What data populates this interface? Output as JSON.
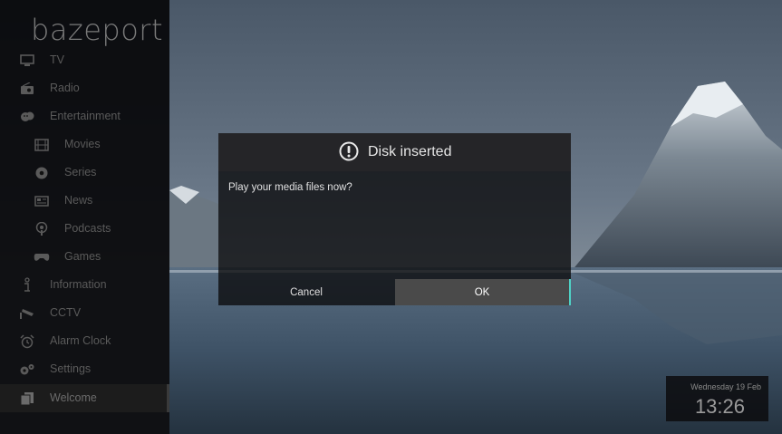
{
  "brand": {
    "logo": "bazeport"
  },
  "sidebar": {
    "items": [
      {
        "label": "TV",
        "icon": "tv-icon"
      },
      {
        "label": "Radio",
        "icon": "radio-icon"
      },
      {
        "label": "Entertainment",
        "icon": "entertainment-icon"
      },
      {
        "label": "Movies",
        "icon": "film-icon"
      },
      {
        "label": "Series",
        "icon": "series-icon"
      },
      {
        "label": "News",
        "icon": "news-icon"
      },
      {
        "label": "Podcasts",
        "icon": "podcast-icon"
      },
      {
        "label": "Games",
        "icon": "gamepad-icon"
      },
      {
        "label": "Information",
        "icon": "info-icon"
      },
      {
        "label": "CCTV",
        "icon": "cctv-icon"
      },
      {
        "label": "Alarm Clock",
        "icon": "alarm-clock-icon"
      },
      {
        "label": "Settings",
        "icon": "settings-icon"
      },
      {
        "label": "Welcome",
        "icon": "welcome-icon"
      }
    ]
  },
  "dialog": {
    "title": "Disk inserted",
    "icon": "alert-icon",
    "message": "Play your media files now?",
    "cancel_label": "Cancel",
    "ok_label": "OK"
  },
  "clock": {
    "date": "Wednesday 19 Feb",
    "time": "13:26"
  },
  "colors": {
    "accent": "#4fd1c5",
    "sidebar_bg": "#08080a",
    "dialog_header": "#262628"
  }
}
